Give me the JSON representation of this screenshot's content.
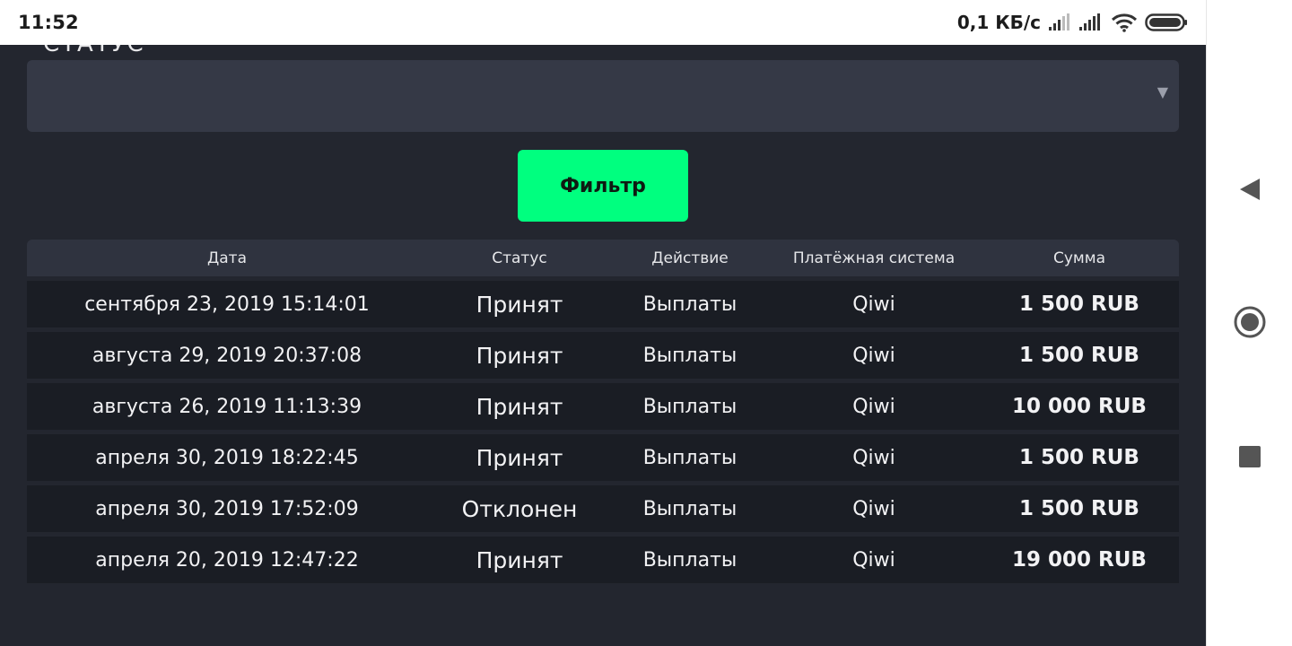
{
  "status_bar": {
    "time": "11:52",
    "net_speed": "0,1 КБ/с"
  },
  "filter": {
    "status_label": "СТАТУС",
    "select_arrow": "▼",
    "button_label": "Фильтр"
  },
  "table": {
    "headers": {
      "date": "Дата",
      "status": "Статус",
      "action": "Действие",
      "system": "Платёжная система",
      "sum": "Сумма"
    },
    "rows": [
      {
        "date": "сентября 23, 2019 15:14:01",
        "status": "Принят",
        "action": "Выплаты",
        "system": "Qiwi",
        "sum": "1 500 RUB"
      },
      {
        "date": "августа 29, 2019 20:37:08",
        "status": "Принят",
        "action": "Выплаты",
        "system": "Qiwi",
        "sum": "1 500 RUB"
      },
      {
        "date": "августа 26, 2019 11:13:39",
        "status": "Принят",
        "action": "Выплаты",
        "system": "Qiwi",
        "sum": "10 000 RUB"
      },
      {
        "date": "апреля 30, 2019 18:22:45",
        "status": "Принят",
        "action": "Выплаты",
        "system": "Qiwi",
        "sum": "1 500 RUB"
      },
      {
        "date": "апреля 30, 2019 17:52:09",
        "status": "Отклонен",
        "action": "Выплаты",
        "system": "Qiwi",
        "sum": "1 500 RUB"
      },
      {
        "date": "апреля 20, 2019 12:47:22",
        "status": "Принят",
        "action": "Выплаты",
        "system": "Qiwi",
        "sum": "19 000 RUB"
      }
    ]
  },
  "colors": {
    "background": "#23262f",
    "select_bg": "#353946",
    "header_bg": "#2f333f",
    "row_bg": "#1a1d24",
    "accent": "#00ff7f"
  },
  "icons": {
    "status": [
      "signal-icon",
      "signal-icon",
      "wifi-icon",
      "battery-icon"
    ],
    "nav": [
      "back-icon",
      "home-icon",
      "recents-icon"
    ]
  }
}
